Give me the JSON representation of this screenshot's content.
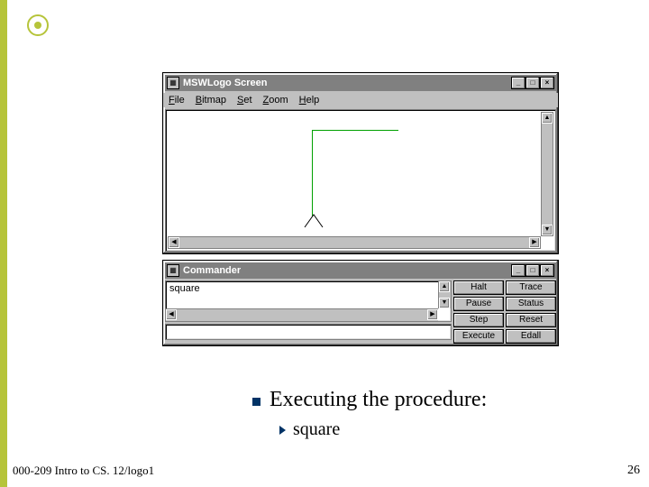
{
  "screen_window": {
    "title": "MSWLogo Screen",
    "menus": [
      {
        "label": "File",
        "underline": "F"
      },
      {
        "label": "Bitmap",
        "underline": "B"
      },
      {
        "label": "Set",
        "underline": "S"
      },
      {
        "label": "Zoom",
        "underline": "Z"
      },
      {
        "label": "Help",
        "underline": "H"
      }
    ]
  },
  "commander_window": {
    "title": "Commander",
    "history_text": "square",
    "input_value": "",
    "buttons": {
      "halt": "Halt",
      "trace": "Trace",
      "pause": "Pause",
      "status": "Status",
      "step": "Step",
      "reset": "Reset",
      "execute": "Execute",
      "edall": "Edall"
    }
  },
  "slide": {
    "bullet_main": "Executing the procedure:",
    "bullet_sub": "square",
    "footer_left": "000-209 Intro to CS. 12/logo1",
    "page_number": "26"
  }
}
